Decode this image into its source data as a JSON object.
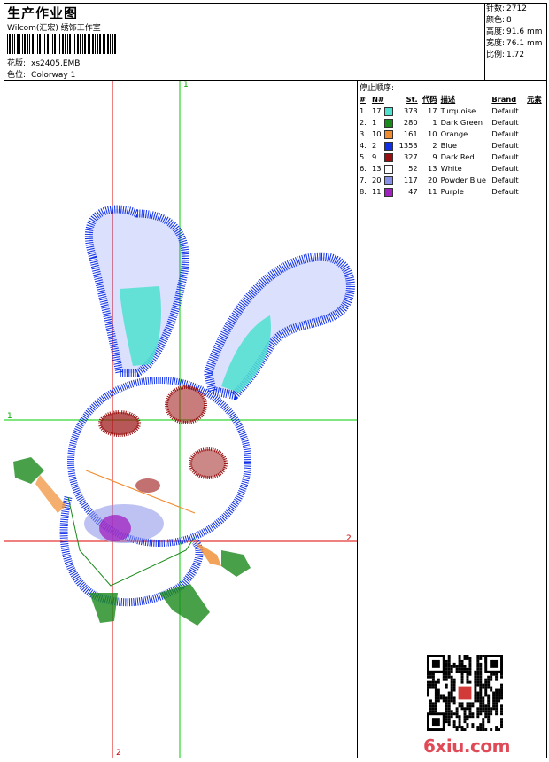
{
  "header": {
    "title": "生产作业图",
    "subtitle": "Wilcom(汇宏) 绣饰工作室",
    "design_label": "花版:",
    "design_value": "xs2405.EMB",
    "colorway_label": "色位:",
    "colorway_value": "Colorway 1"
  },
  "stats": [
    {
      "label": "针数:",
      "value": "2712"
    },
    {
      "label": "颜色:",
      "value": "8"
    },
    {
      "label": "高度:",
      "value": "91.6 mm"
    },
    {
      "label": "宽度:",
      "value": "76.1 mm"
    },
    {
      "label": "比例:",
      "value": "1.72"
    }
  ],
  "threads": {
    "title": "停止顺序:",
    "headers": {
      "num": "#",
      "n": "N#",
      "st": "St.",
      "code": "代码",
      "desc": "描述",
      "brand": "Brand",
      "element": "元素"
    },
    "rows": [
      {
        "num": "1.",
        "n": "17",
        "color": "#4fe0d0",
        "st": "373",
        "code": "17",
        "desc": "Turquoise",
        "brand": "Default"
      },
      {
        "num": "2.",
        "n": "1",
        "color": "#1a8a1a",
        "st": "280",
        "code": "1",
        "desc": "Dark Green",
        "brand": "Default"
      },
      {
        "num": "3.",
        "n": "10",
        "color": "#f08c30",
        "st": "161",
        "code": "10",
        "desc": "Orange",
        "brand": "Default"
      },
      {
        "num": "4.",
        "n": "2",
        "color": "#1030e8",
        "st": "1353",
        "code": "2",
        "desc": "Blue",
        "brand": "Default"
      },
      {
        "num": "5.",
        "n": "9",
        "color": "#9a1010",
        "st": "327",
        "code": "9",
        "desc": "Dark Red",
        "brand": "Default"
      },
      {
        "num": "6.",
        "n": "13",
        "color": "#ffffff",
        "st": "52",
        "code": "13",
        "desc": "White",
        "brand": "Default"
      },
      {
        "num": "7.",
        "n": "20",
        "color": "#8890e8",
        "st": "117",
        "code": "20",
        "desc": "Powder Blue",
        "brand": "Default"
      },
      {
        "num": "8.",
        "n": "11",
        "color": "#a020c0",
        "st": "47",
        "code": "11",
        "desc": "Purple",
        "brand": "Default"
      }
    ]
  },
  "guides": {
    "green_top": "1",
    "green_left": "1",
    "red_right": "2",
    "red_bottom": "2"
  },
  "watermark": "6xiu.com",
  "colors": {
    "guide_green": "#00cc00",
    "guide_red": "#dd0000"
  }
}
